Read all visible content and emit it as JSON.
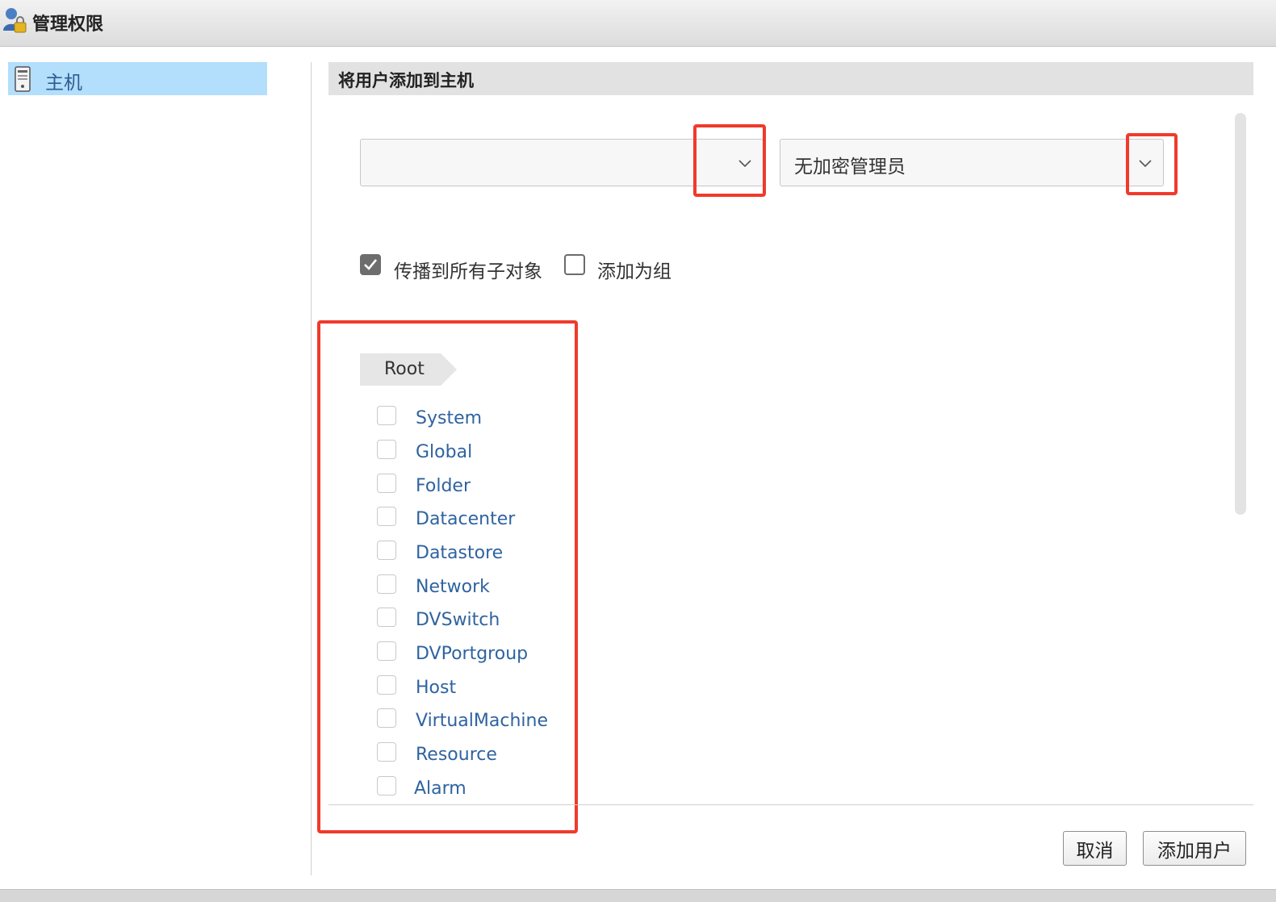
{
  "window": {
    "title": "管理权限",
    "icon": "user-lock-icon"
  },
  "sidebar": {
    "items": [
      {
        "label": "主机",
        "icon": "host-server-icon",
        "selected": true
      }
    ]
  },
  "section": {
    "title": "将用户添加到主机"
  },
  "form": {
    "user_select": {
      "value": "",
      "icon": "chevron-down-icon"
    },
    "role_select": {
      "value": "无加密管理员",
      "icon": "chevron-down-icon"
    },
    "propagate": {
      "label": "传播到所有子对象",
      "checked": true
    },
    "add_as_group": {
      "label": "添加为组",
      "checked": false
    }
  },
  "privileges": {
    "breadcrumb": "Root",
    "items": [
      {
        "label": "System",
        "checked": false
      },
      {
        "label": "Global",
        "checked": false
      },
      {
        "label": "Folder",
        "checked": false
      },
      {
        "label": "Datacenter",
        "checked": false
      },
      {
        "label": "Datastore",
        "checked": false
      },
      {
        "label": "Network",
        "checked": false
      },
      {
        "label": "DVSwitch",
        "checked": false
      },
      {
        "label": "DVPortgroup",
        "checked": false
      },
      {
        "label": "Host",
        "checked": false
      },
      {
        "label": "VirtualMachine",
        "checked": false
      },
      {
        "label": "Resource",
        "checked": false
      },
      {
        "label": "Alarm",
        "checked": false
      }
    ]
  },
  "buttons": {
    "cancel": "取消",
    "add_user": "添加用户"
  },
  "colors": {
    "annotation": "#f03a2b",
    "link": "#2f63a0",
    "selected_nav": "#b3defc"
  }
}
